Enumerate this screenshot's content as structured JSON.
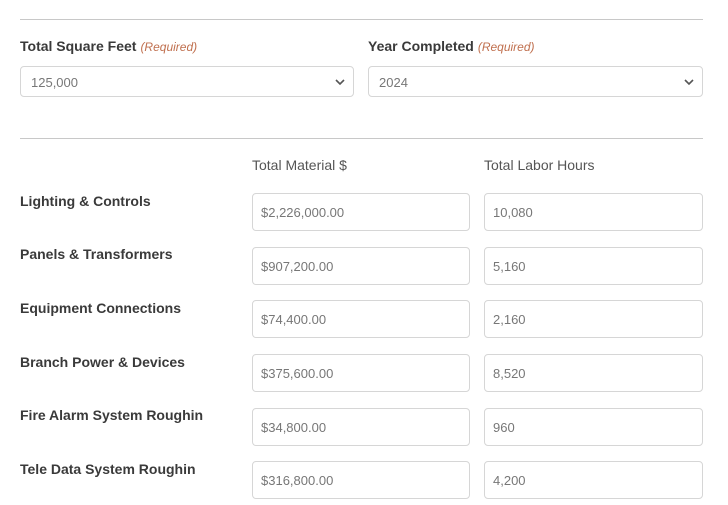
{
  "form": {
    "square_feet": {
      "label": "Total Square Feet",
      "required": "(Required)",
      "value": "125,000"
    },
    "year_completed": {
      "label": "Year Completed",
      "required": "(Required)",
      "value": "2024"
    }
  },
  "table": {
    "headers": {
      "material": "Total Material $",
      "labor": "Total Labor Hours"
    },
    "rows": [
      {
        "label": "Lighting & Controls",
        "material": "$2,226,000.00",
        "labor": "10,080"
      },
      {
        "label": "Panels & Transformers",
        "material": "$907,200.00",
        "labor": "5,160"
      },
      {
        "label": "Equipment Connections",
        "material": "$74,400.00",
        "labor": "2,160"
      },
      {
        "label": "Branch Power & Devices",
        "material": "$375,600.00",
        "labor": "8,520"
      },
      {
        "label": "Fire Alarm System Roughin",
        "material": "$34,800.00",
        "labor": "960"
      },
      {
        "label": "Tele Data System Roughin",
        "material": "$316,800.00",
        "labor": "4,200"
      }
    ]
  },
  "icons": {
    "select_arrow": "chevron-down-icon"
  }
}
